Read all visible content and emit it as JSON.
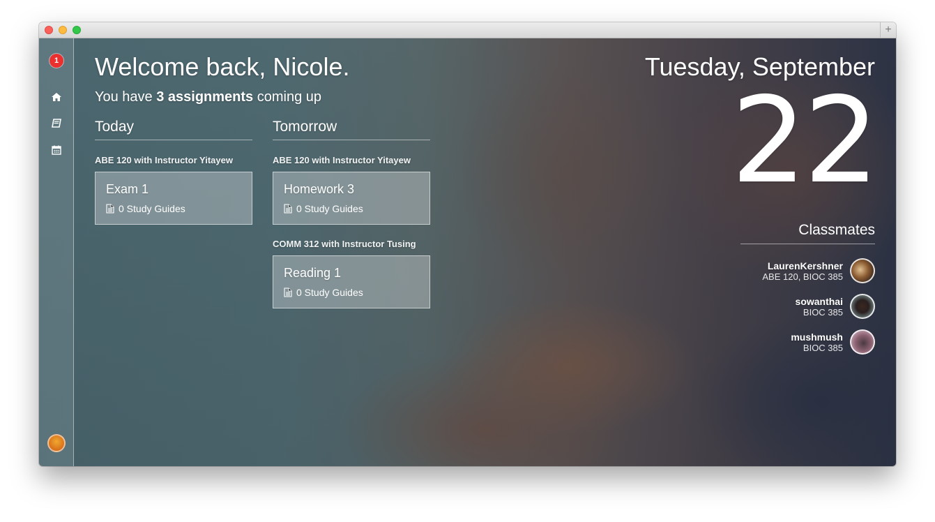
{
  "sidebar": {
    "notification_count": "1",
    "items": [
      {
        "icon": "home-icon"
      },
      {
        "icon": "book-icon"
      },
      {
        "icon": "calendar-icon"
      }
    ]
  },
  "header": {
    "welcome": "Welcome back, Nicole.",
    "subtitle_prefix": "You have ",
    "subtitle_bold": "3 assignments",
    "subtitle_suffix": " coming up"
  },
  "today": {
    "heading": "Today",
    "groups": [
      {
        "course": "ABE 120 with Instructor Yitayew",
        "cards": [
          {
            "title": "Exam 1",
            "study_guides": "0 Study Guides"
          }
        ]
      }
    ]
  },
  "tomorrow": {
    "heading": "Tomorrow",
    "groups": [
      {
        "course": "ABE 120 with Instructor Yitayew",
        "cards": [
          {
            "title": "Homework 3",
            "study_guides": "0 Study Guides"
          }
        ]
      },
      {
        "course": "COMM 312 with Instructor Tusing",
        "cards": [
          {
            "title": "Reading 1",
            "study_guides": "0 Study Guides"
          }
        ]
      }
    ]
  },
  "date": {
    "weekday_month": "Tuesday, September",
    "day": "22"
  },
  "classmates": {
    "heading": "Classmates",
    "list": [
      {
        "name": "LaurenKershner",
        "courses": "ABE 120, BIOC 385"
      },
      {
        "name": "sowanthai",
        "courses": "BIOC 385"
      },
      {
        "name": "mushmush",
        "courses": "BIOC 385"
      }
    ]
  },
  "colors": {
    "badge": "#ea2f2f",
    "text": "#ffffff"
  }
}
